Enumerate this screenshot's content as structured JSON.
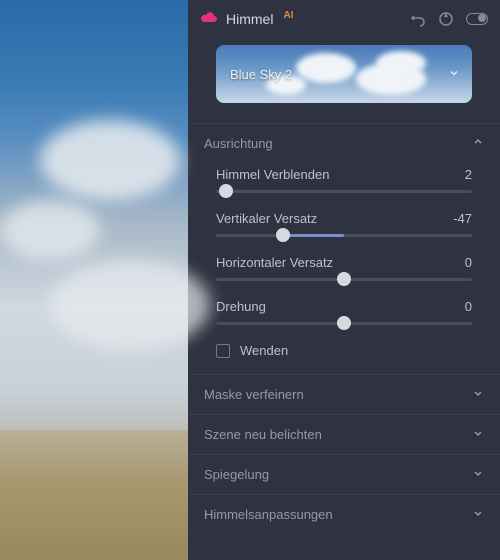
{
  "header": {
    "title": "Himmel",
    "ai_badge": "AI"
  },
  "preset": {
    "label": "Blue Sky 2"
  },
  "sections": {
    "ausrichtung": {
      "label": "Ausrichtung",
      "expanded": true
    },
    "maske": {
      "label": "Maske verfeinern"
    },
    "szene": {
      "label": "Szene neu belichten"
    },
    "spiegelung": {
      "label": "Spiegelung"
    },
    "himmelsanp": {
      "label": "Himmelsanpassungen"
    }
  },
  "sliders": {
    "verblenden": {
      "label": "Himmel Verblenden",
      "value": 2,
      "pct": 4
    },
    "vertikal": {
      "label": "Vertikaler Versatz",
      "value": -47,
      "pct": 26,
      "fill_from": 26,
      "fill_to": 50
    },
    "horizontal": {
      "label": "Horizontaler Versatz",
      "value": 0,
      "pct": 50
    },
    "drehung": {
      "label": "Drehung",
      "value": 0,
      "pct": 50
    }
  },
  "checkbox": {
    "wenden": {
      "label": "Wenden",
      "checked": false
    }
  }
}
